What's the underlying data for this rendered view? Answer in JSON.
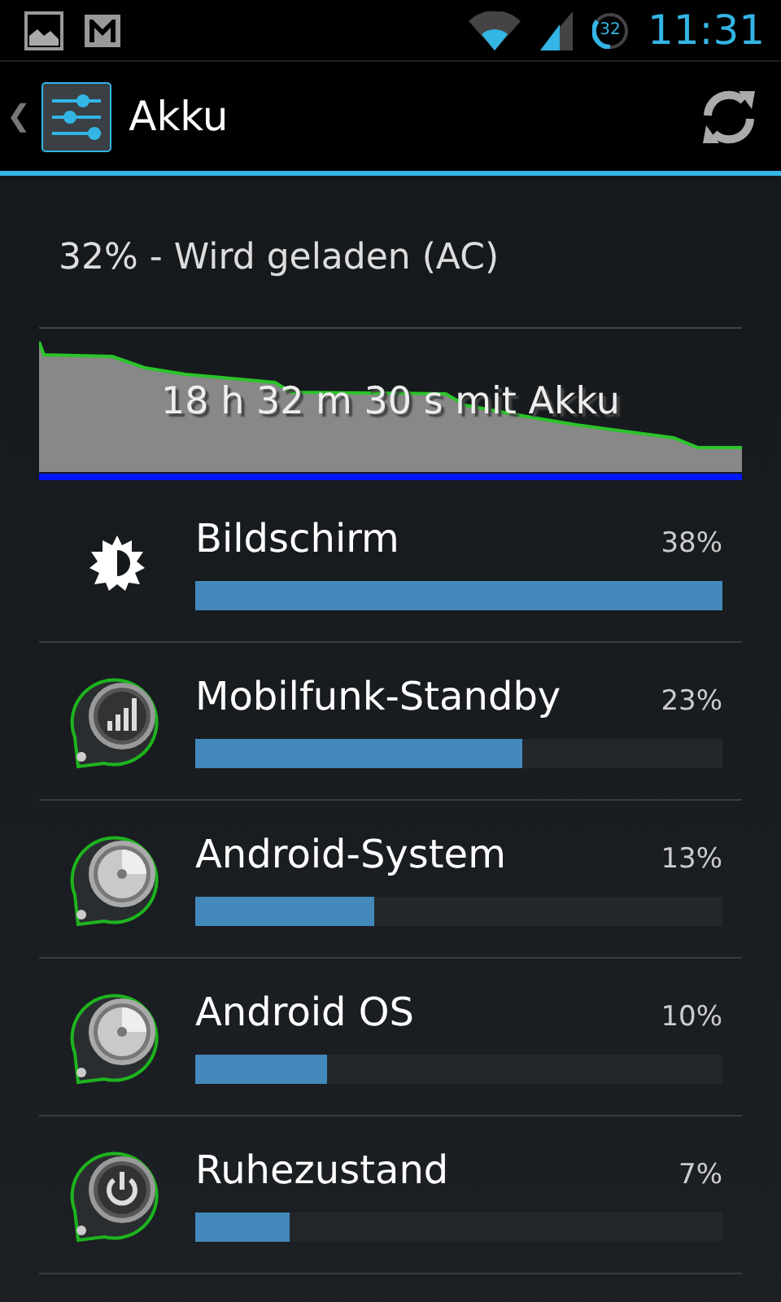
{
  "status_bar": {
    "battery_level_text": "32",
    "time": "11:31"
  },
  "action_bar": {
    "back": "❮",
    "title": "Akku"
  },
  "summary": "32% - Wird geladen (AC)",
  "graph": {
    "caption": "18 h 32 m 30 s mit Akku"
  },
  "items": [
    {
      "kind": "brightness",
      "name": "Bildschirm",
      "percent": "38%",
      "level": 1.0
    },
    {
      "kind": "signal",
      "name": "Mobilfunk-Standby",
      "percent": "23%",
      "level": 0.62
    },
    {
      "kind": "disc",
      "name": "Android-System",
      "percent": "13%",
      "level": 0.34
    },
    {
      "kind": "disc",
      "name": "Android OS",
      "percent": "10%",
      "level": 0.25
    },
    {
      "kind": "power",
      "name": "Ruhezustand",
      "percent": "7%",
      "level": 0.18
    }
  ]
}
